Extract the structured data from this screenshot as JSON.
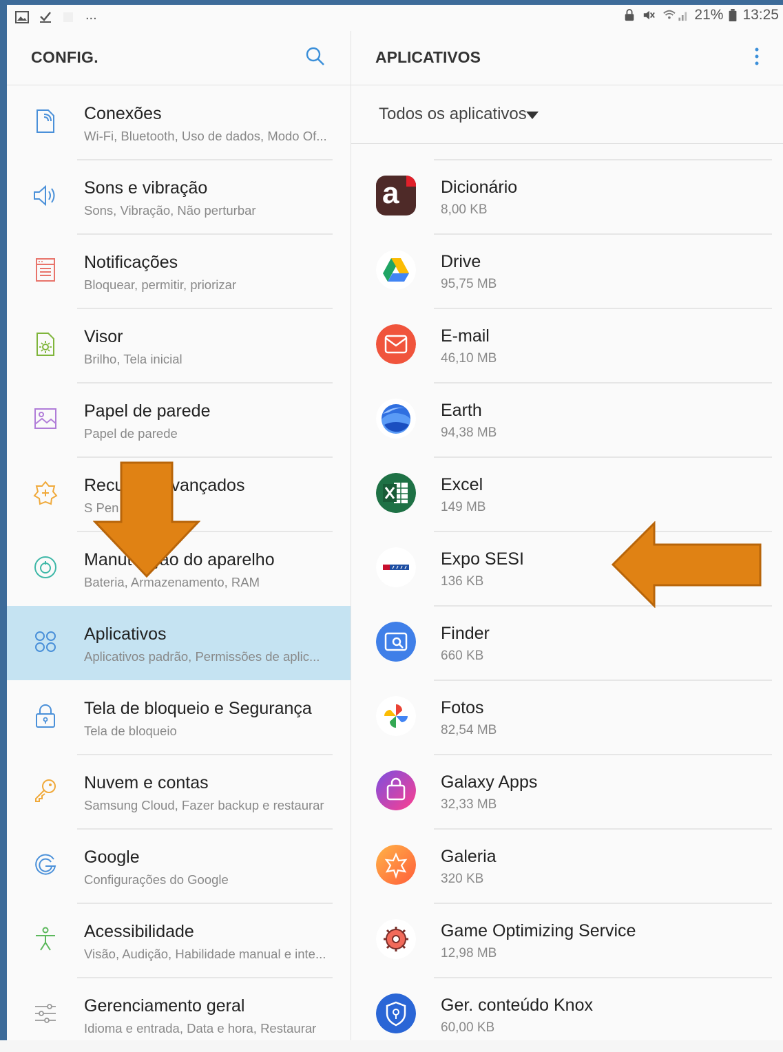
{
  "status_bar": {
    "more": "...",
    "battery": "21%",
    "time": "13:25"
  },
  "left_pane": {
    "title": "CONFIG.",
    "items": [
      {
        "title": "Conexões",
        "subtitle": "Wi-Fi, Bluetooth, Uso de dados, Modo Of...",
        "icon": "connections-icon"
      },
      {
        "title": "Sons e vibração",
        "subtitle": "Sons, Vibração, Não perturbar",
        "icon": "sound-icon"
      },
      {
        "title": "Notificações",
        "subtitle": "Bloquear, permitir, priorizar",
        "icon": "notifications-icon"
      },
      {
        "title": "Visor",
        "subtitle": "Brilho, Tela inicial",
        "icon": "display-icon"
      },
      {
        "title": "Papel de parede",
        "subtitle": "Papel de parede",
        "icon": "wallpaper-icon"
      },
      {
        "title": "Recursos avançados",
        "subtitle": "S Pen",
        "icon": "advanced-features-icon"
      },
      {
        "title": "Manutenção do aparelho",
        "subtitle": "Bateria, Armazenamento, RAM",
        "icon": "device-maintenance-icon"
      },
      {
        "title": "Aplicativos",
        "subtitle": "Aplicativos padrão, Permissões de aplic...",
        "icon": "apps-icon"
      },
      {
        "title": "Tela de bloqueio e Segurança",
        "subtitle": "Tela de bloqueio",
        "icon": "lock-icon"
      },
      {
        "title": "Nuvem e contas",
        "subtitle": "Samsung Cloud, Fazer backup e restaurar",
        "icon": "key-icon"
      },
      {
        "title": "Google",
        "subtitle": "Configurações do Google",
        "icon": "google-icon"
      },
      {
        "title": "Acessibilidade",
        "subtitle": "Visão, Audição, Habilidade manual e inte...",
        "icon": "accessibility-icon"
      },
      {
        "title": "Gerenciamento geral",
        "subtitle": "Idioma e entrada, Data e hora, Restaurar",
        "icon": "general-management-icon"
      }
    ]
  },
  "right_pane": {
    "title": "APLICATIVOS",
    "filter": "Todos os aplicativos",
    "apps": [
      {
        "name": "Dicionário",
        "size": "8,00 KB",
        "icon": "dictionary-icon",
        "icon_letter": "a"
      },
      {
        "name": "Drive",
        "size": "95,75 MB",
        "icon": "drive-icon"
      },
      {
        "name": "E-mail",
        "size": "46,10 MB",
        "icon": "email-icon"
      },
      {
        "name": "Earth",
        "size": "94,38 MB",
        "icon": "earth-icon"
      },
      {
        "name": "Excel",
        "size": "149 MB",
        "icon": "excel-icon"
      },
      {
        "name": "Expo SESI",
        "size": "136 KB",
        "icon": "expo-sesi-icon"
      },
      {
        "name": "Finder",
        "size": "660 KB",
        "icon": "finder-icon"
      },
      {
        "name": "Fotos",
        "size": "82,54 MB",
        "icon": "photos-icon"
      },
      {
        "name": "Galaxy Apps",
        "size": "32,33 MB",
        "icon": "galaxy-apps-icon"
      },
      {
        "name": "Galeria",
        "size": "320 KB",
        "icon": "gallery-icon"
      },
      {
        "name": "Game Optimizing Service",
        "size": "12,98 MB",
        "icon": "game-optimizing-icon"
      },
      {
        "name": "Ger. conteúdo Knox",
        "size": "60,00 KB",
        "icon": "knox-icon"
      }
    ]
  },
  "colors": {
    "active_item": "#c5e3f2",
    "annotation_arrow": "#e08214",
    "frame": "#3d6b99"
  }
}
